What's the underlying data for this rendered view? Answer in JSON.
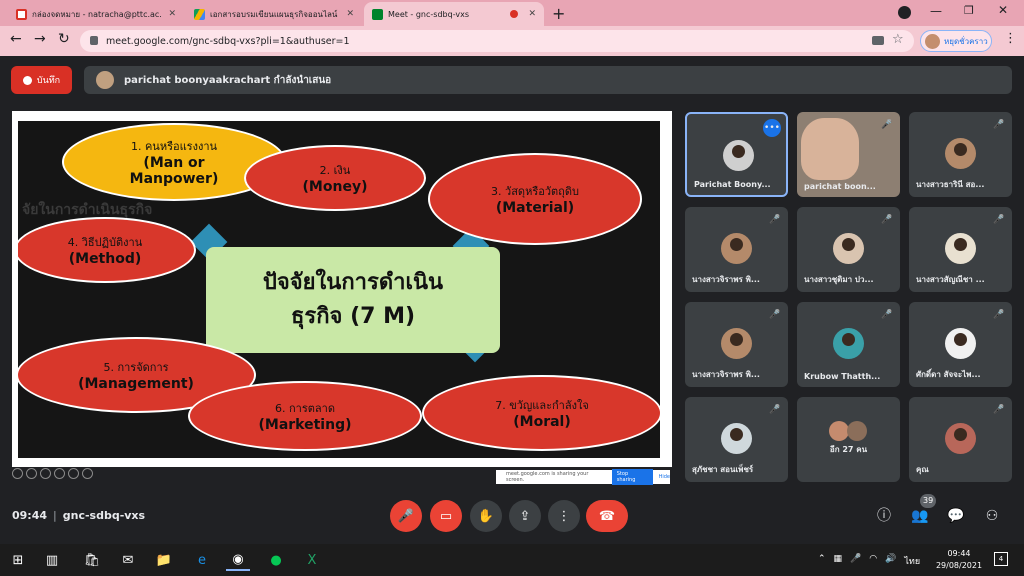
{
  "browser": {
    "tabs": [
      {
        "label": "กล่องจดหมาย - natracha@pttc.ac.t",
        "favicon": "gmail-icon"
      },
      {
        "label": "เอกสารอบรมเขียนแผนธุรกิจออนไลน์ ปี",
        "favicon": "drive-icon"
      },
      {
        "label": "Meet - gnc-sdbq-vxs",
        "favicon": "meet-icon"
      }
    ],
    "url": "meet.google.com/gnc-sdbq-vxs?pli=1&authuser=1",
    "profile_label": "หยุดชั่วคราว"
  },
  "meet": {
    "record_label": "บันทึก",
    "presenter_text": "parichat boonyaakrachart กำลังนำเสนอ",
    "time": "09:44",
    "meeting_code": "gnc-sdbq-vxs",
    "participant_count": "39"
  },
  "slide": {
    "bg_text": "จัยในการดำเนินธุรกิจ",
    "items": [
      {
        "num": "1. คนหรือแรงงาน",
        "en1": "(Man or",
        "en2": "Manpower)"
      },
      {
        "num": "2. เงิน",
        "en1": "(Money)"
      },
      {
        "num": "3. วัสดุหรือวัตถุดิบ",
        "en1": "(Material)"
      },
      {
        "num": "4. วิธีปฏิบัติงาน",
        "en1": "(Method)"
      },
      {
        "num": "5. การจัดการ",
        "en1": "(Management)"
      },
      {
        "num": "6. การตลาด",
        "en1": "(Marketing)"
      },
      {
        "num": "7. ขวัญและกำลังใจ",
        "en1": "(Moral)"
      }
    ],
    "center_line1": "ปัจจัยในการดำเนิน",
    "center_line2": "ธุรกิจ (7 M)",
    "share_notice": "meet.google.com is sharing your screen.",
    "stop_sharing": "Stop sharing",
    "hide": "Hide"
  },
  "participants": [
    {
      "name": "Parichat Boony..."
    },
    {
      "name": "parichat boon..."
    },
    {
      "name": "นางสาวธารินี สอ..."
    },
    {
      "name": "นางสาวจิราพร พิ..."
    },
    {
      "name": "นางสาวชุติมา ปว..."
    },
    {
      "name": "นางสาวสัญณีชา ..."
    },
    {
      "name": "นางสาวจิราพร พิ..."
    },
    {
      "name": "Krubow Thatth..."
    },
    {
      "name": "ศักดิ์ดา สัจจะไพ..."
    },
    {
      "name": "สุภัชชา สอนเพ็ชร์"
    },
    {
      "name": "อีก 27 คน"
    },
    {
      "name": "คุณ"
    }
  ],
  "taskbar": {
    "time": "09:44",
    "date": "29/08/2021",
    "lang": "ไทย",
    "notif": "4"
  }
}
